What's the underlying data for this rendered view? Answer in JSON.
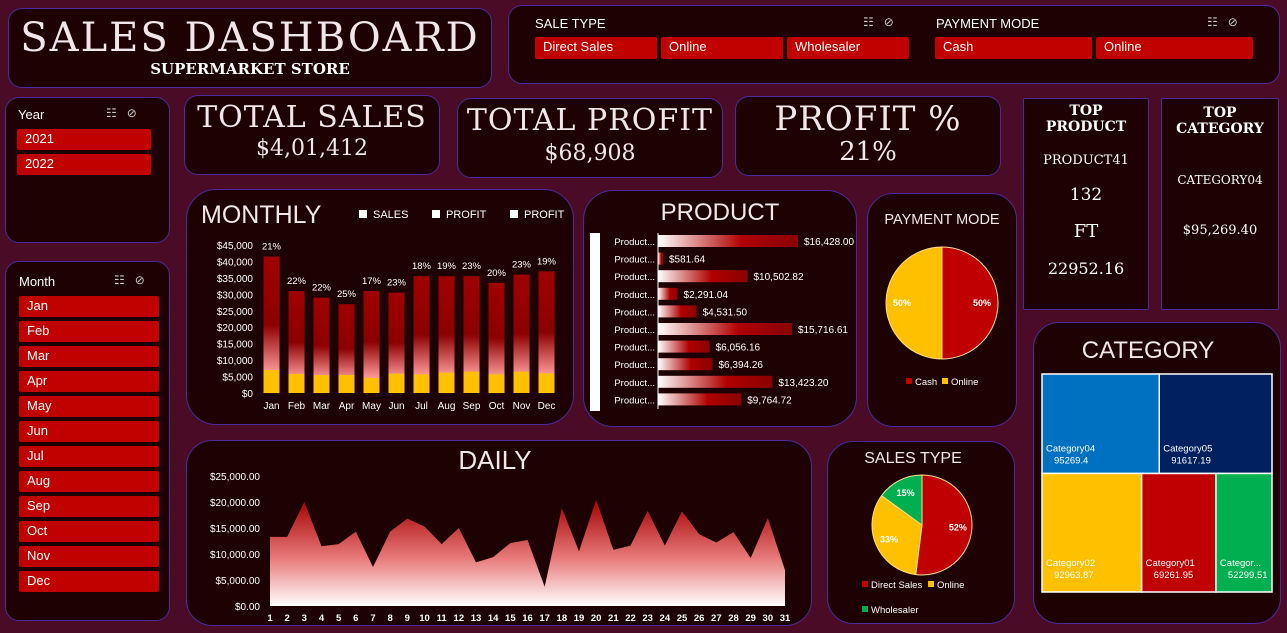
{
  "header": {
    "title": "SALES DASHBOARD",
    "subtitle": "SUPERMARKET STORE"
  },
  "sale_type_slicer": {
    "title": "SALE TYPE",
    "options": [
      "Direct Sales",
      "Online",
      "Wholesaler"
    ]
  },
  "payment_mode_slicer": {
    "title": "PAYMENT MODE",
    "options": [
      "Cash",
      "Online"
    ]
  },
  "year_slicer": {
    "title": "Year",
    "options": [
      "2021",
      "2022"
    ]
  },
  "month_slicer": {
    "title": "Month",
    "options": [
      "Jan",
      "Feb",
      "Mar",
      "Apr",
      "May",
      "Jun",
      "Jul",
      "Aug",
      "Sep",
      "Oct",
      "Nov",
      "Dec"
    ]
  },
  "kpis": {
    "total_sales": {
      "label": "TOTAL SALES",
      "value": "$4,01,412"
    },
    "total_profit": {
      "label": "TOTAL PROFIT",
      "value": "$68,908"
    },
    "profit_pct": {
      "label": "PROFIT %",
      "value": "21%"
    }
  },
  "top_product": {
    "title_line1": "TOP",
    "title_line2": "PRODUCT",
    "name": "PRODUCT41",
    "qty": "132",
    "unit": "FT",
    "value": "22952.16"
  },
  "top_category": {
    "title_line1": "TOP",
    "title_line2": "CATEGORY",
    "name": "CATEGORY04",
    "value": "$95,269.40"
  },
  "colors": {
    "background": "#4a0b26",
    "panel": "#1e0103",
    "accent_red": "#c10000",
    "amber": "#ffc000",
    "blue": "#0070c0",
    "navy": "#002060",
    "green": "#00b050"
  },
  "chart_data": [
    {
      "type": "bar",
      "title": "MONTHLY",
      "legend": [
        "SALES",
        "PROFIT",
        "PROFIT"
      ],
      "categories": [
        "Jan",
        "Feb",
        "Mar",
        "Apr",
        "May",
        "Jun",
        "Jul",
        "Aug",
        "Sep",
        "Oct",
        "Nov",
        "Dec"
      ],
      "series": [
        {
          "name": "SALES",
          "values": [
            41500,
            31000,
            29000,
            27000,
            31000,
            30500,
            35500,
            35500,
            35500,
            33500,
            36000,
            37000
          ]
        },
        {
          "name": "PROFIT",
          "values": [
            7000,
            5800,
            5500,
            5500,
            4600,
            5900,
            5700,
            6200,
            6500,
            5700,
            6500,
            6000
          ]
        }
      ],
      "data_labels": [
        "21%",
        "22%",
        "22%",
        "25%",
        "17%",
        "23%",
        "18%",
        "19%",
        "23%",
        "20%",
        "23%",
        "19%"
      ],
      "y_ticks": [
        "$0",
        "$5,000",
        "$10,000",
        "$15,000",
        "$20,000",
        "$25,000",
        "$30,000",
        "$35,000",
        "$40,000",
        "$45,000"
      ],
      "ylim": [
        0,
        45000
      ]
    },
    {
      "type": "bar",
      "title": "PRODUCT",
      "orientation": "horizontal",
      "categories": [
        "Product...",
        "Product...",
        "Product...",
        "Product...",
        "Product...",
        "Product...",
        "Product...",
        "Product...",
        "Product...",
        "Product..."
      ],
      "values": [
        16428.0,
        581.64,
        10502.82,
        2291.04,
        4531.5,
        15716.61,
        6056.16,
        6394.26,
        13423.2,
        9764.72
      ],
      "value_labels": [
        "$16,428.00",
        "$581.64",
        "$10,502.82",
        "$2,291.04",
        "$4,531.50",
        "$15,716.61",
        "$6,056.16",
        "$6,394.26",
        "$13,423.20",
        "$9,764.72"
      ]
    },
    {
      "type": "pie",
      "title": "PAYMENT MODE",
      "labels": [
        "Cash",
        "Online"
      ],
      "values": [
        50,
        50
      ],
      "value_labels": [
        "50%",
        "50%"
      ],
      "colors": [
        "#c00000",
        "#ffc000"
      ]
    },
    {
      "type": "area",
      "title": "DAILY",
      "x": [
        1,
        2,
        3,
        4,
        5,
        6,
        7,
        8,
        9,
        10,
        11,
        12,
        13,
        14,
        15,
        16,
        17,
        18,
        19,
        20,
        21,
        22,
        23,
        24,
        25,
        26,
        27,
        28,
        29,
        30,
        31
      ],
      "values": [
        13300,
        13300,
        20000,
        11500,
        11900,
        14300,
        7500,
        14300,
        16800,
        15300,
        11900,
        15000,
        8400,
        9400,
        12100,
        12700,
        3700,
        18800,
        10500,
        20400,
        10800,
        11600,
        18300,
        11600,
        18200,
        13800,
        12200,
        14200,
        9200,
        16900,
        6900
      ],
      "y_ticks": [
        "$0.00",
        "$5,000.00",
        "$10,000.00",
        "$15,000.00",
        "$20,000.00",
        "$25,000.00"
      ],
      "ylim": [
        0,
        25000
      ]
    },
    {
      "type": "pie",
      "title": "SALES TYPE",
      "labels": [
        "Direct Sales",
        "Online",
        "Wholesaler"
      ],
      "values": [
        52,
        33,
        15
      ],
      "value_labels": [
        "52%",
        "33%",
        "15%"
      ],
      "colors": [
        "#c00000",
        "#ffc000",
        "#00b050"
      ]
    },
    {
      "type": "treemap",
      "title": "CATEGORY",
      "labels": [
        "Category04",
        "Category05",
        "Category02",
        "Category01",
        "Categor..."
      ],
      "values": [
        95269.4,
        91617.19,
        92963.87,
        69261.95,
        52299.51
      ],
      "value_labels": [
        "95269.4",
        "91617.19",
        "92963.87",
        "69261.95",
        "52299.51"
      ],
      "colors": [
        "#0070c0",
        "#002060",
        "#ffc000",
        "#c00000",
        "#00b050"
      ]
    }
  ]
}
